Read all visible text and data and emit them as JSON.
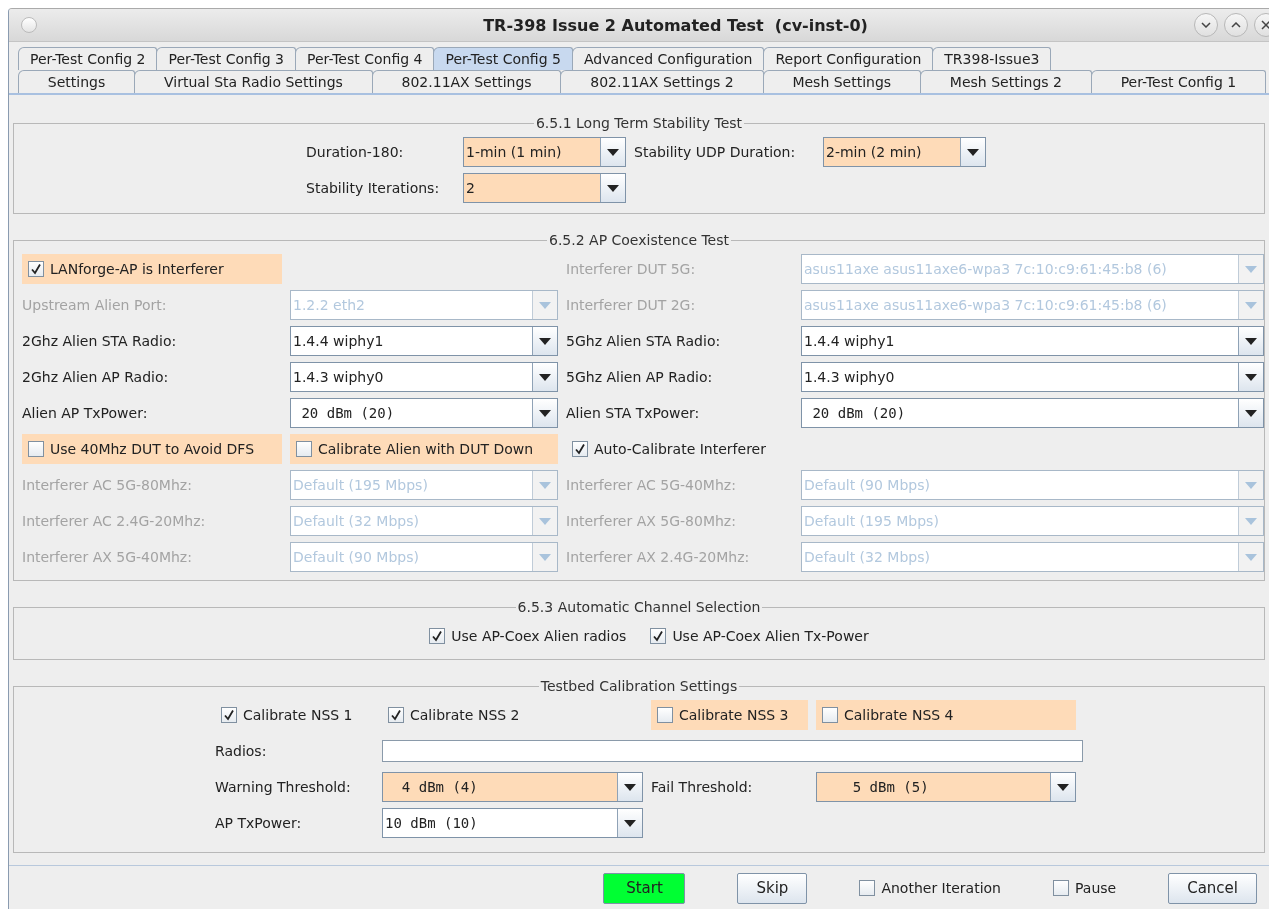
{
  "window": {
    "title": "TR-398 Issue 2 Automated Test  (cv-inst-0)"
  },
  "tab_rows": [
    [
      {
        "label": "Per-Test Config 2",
        "selected": false
      },
      {
        "label": "Per-Test Config 3",
        "selected": false
      },
      {
        "label": "Per-Test Config 4",
        "selected": false
      },
      {
        "label": "Per-Test Config 5",
        "selected": true
      },
      {
        "label": "Advanced Configuration",
        "selected": false
      },
      {
        "label": "Report Configuration",
        "selected": false
      },
      {
        "label": "TR398-Issue3",
        "selected": false
      }
    ],
    [
      {
        "label": "Settings",
        "selected": false
      },
      {
        "label": "Virtual Sta Radio Settings",
        "selected": false
      },
      {
        "label": "802.11AX Settings",
        "selected": false
      },
      {
        "label": "802.11AX Settings 2",
        "selected": false
      },
      {
        "label": "Mesh Settings",
        "selected": false
      },
      {
        "label": "Mesh Settings 2",
        "selected": false
      },
      {
        "label": "Per-Test Config 1",
        "selected": false
      }
    ]
  ],
  "sections": [
    {
      "title": "6.5.1 Long Term Stability Test",
      "rows": [
        [
          {
            "kind": "dropdown",
            "label": "Duration-180:",
            "value": "1-min (1 min)",
            "highlight": true,
            "disabled": false,
            "mono": false
          },
          {
            "kind": "dropdown",
            "label": "Stability UDP Duration:",
            "value": "2-min (2 min)",
            "highlight": true,
            "disabled": false,
            "mono": false
          }
        ],
        [
          {
            "kind": "dropdown",
            "label": "Stability Iterations:",
            "value": "2",
            "highlight": true,
            "disabled": false,
            "mono": false
          }
        ]
      ]
    },
    {
      "title": "6.5.2 AP Coexistence Test",
      "rows": [
        [
          {
            "kind": "checkbox",
            "label": "LANforge-AP is Interferer",
            "checked": true,
            "highlight": true
          },
          {
            "kind": "dropdown",
            "label": "Interferer DUT 5G:",
            "value": "asus11axe asus11axe6-wpa3 7c:10:c9:61:45:b8 (6)",
            "highlight": false,
            "disabled": true,
            "mono": false
          }
        ],
        [
          {
            "kind": "dropdown",
            "label": "Upstream Alien Port:",
            "value": "1.2.2 eth2",
            "highlight": false,
            "disabled": true,
            "mono": false
          },
          {
            "kind": "dropdown",
            "label": "Interferer DUT 2G:",
            "value": "asus11axe asus11axe6-wpa3 7c:10:c9:61:45:b8 (6)",
            "highlight": false,
            "disabled": true,
            "mono": false
          }
        ],
        [
          {
            "kind": "dropdown",
            "label": "2Ghz Alien STA Radio:",
            "value": "1.4.4 wiphy1",
            "highlight": false,
            "disabled": false,
            "mono": false
          },
          {
            "kind": "dropdown",
            "label": "5Ghz Alien STA Radio:",
            "value": "1.4.4 wiphy1",
            "highlight": false,
            "disabled": false,
            "mono": false
          }
        ],
        [
          {
            "kind": "dropdown",
            "label": "2Ghz Alien AP Radio:",
            "value": "1.4.3 wiphy0",
            "highlight": false,
            "disabled": false,
            "mono": false
          },
          {
            "kind": "dropdown",
            "label": "5Ghz Alien AP Radio:",
            "value": "1.4.3 wiphy0",
            "highlight": false,
            "disabled": false,
            "mono": false
          }
        ],
        [
          {
            "kind": "dropdown",
            "label": "Alien AP TxPower:",
            "value": " 20 dBm (20)",
            "highlight": false,
            "disabled": false,
            "mono": true
          },
          {
            "kind": "dropdown",
            "label": "Alien STA TxPower:",
            "value": " 20 dBm (20)",
            "highlight": false,
            "disabled": false,
            "mono": true
          }
        ],
        [
          {
            "kind": "checkbox",
            "label": "Use 40Mhz DUT to Avoid DFS",
            "checked": false,
            "highlight": true
          },
          {
            "kind": "checkbox",
            "label": "Calibrate Alien with DUT Down",
            "checked": false,
            "highlight": true
          },
          {
            "kind": "checkbox",
            "label": "Auto-Calibrate Interferer",
            "checked": true,
            "highlight": false
          }
        ],
        [
          {
            "kind": "dropdown",
            "label": "Interferer AC 5G-80Mhz:",
            "value": "Default (195 Mbps)",
            "highlight": false,
            "disabled": true,
            "mono": false
          },
          {
            "kind": "dropdown",
            "label": "Interferer AC 5G-40Mhz:",
            "value": "Default (90 Mbps)",
            "highlight": false,
            "disabled": true,
            "mono": false
          }
        ],
        [
          {
            "kind": "dropdown",
            "label": "Interferer AC 2.4G-20Mhz:",
            "value": "Default (32 Mbps)",
            "highlight": false,
            "disabled": true,
            "mono": false
          },
          {
            "kind": "dropdown",
            "label": "Interferer AX 5G-80Mhz:",
            "value": "Default (195 Mbps)",
            "highlight": false,
            "disabled": true,
            "mono": false
          }
        ],
        [
          {
            "kind": "dropdown",
            "label": "Interferer AX 5G-40Mhz:",
            "value": "Default (90 Mbps)",
            "highlight": false,
            "disabled": true,
            "mono": false
          },
          {
            "kind": "dropdown",
            "label": "Interferer AX 2.4G-20Mhz:",
            "value": "Default (32 Mbps)",
            "highlight": false,
            "disabled": true,
            "mono": false
          }
        ]
      ]
    },
    {
      "title": "6.5.3 Automatic Channel Selection",
      "rows": [
        [
          {
            "kind": "checkbox",
            "label": "Use AP-Coex Alien radios",
            "checked": true,
            "highlight": false
          },
          {
            "kind": "checkbox",
            "label": "Use AP-Coex Alien Tx-Power",
            "checked": true,
            "highlight": false
          }
        ]
      ]
    },
    {
      "title": "Testbed Calibration Settings",
      "checkboxes": [
        {
          "label": "Calibrate NSS 1",
          "checked": true,
          "highlight": false
        },
        {
          "label": "Calibrate NSS 2",
          "checked": true,
          "highlight": false
        },
        {
          "label": "Calibrate NSS 3",
          "checked": false,
          "highlight": true
        },
        {
          "label": "Calibrate NSS 4",
          "checked": false,
          "highlight": true
        }
      ],
      "rows": [
        [
          {
            "kind": "text",
            "label": "Radios:"
          }
        ],
        [
          {
            "kind": "dropdown",
            "label": "Warning Threshold:",
            "value": "  4 dBm (4)",
            "highlight": true,
            "disabled": false,
            "mono": true
          },
          {
            "kind": "dropdown",
            "label": "Fail Threshold:",
            "value": "    5 dBm (5)",
            "highlight": true,
            "disabled": false,
            "mono": true
          }
        ],
        [
          {
            "kind": "dropdown",
            "label": "AP TxPower:",
            "value": "10 dBm (10)",
            "highlight": false,
            "disabled": false,
            "mono": true
          }
        ]
      ]
    }
  ],
  "buttons": [
    {
      "kind": "button",
      "label": "Start",
      "primary": true
    },
    {
      "kind": "button",
      "label": "Skip",
      "primary": false
    },
    {
      "kind": "checkbox",
      "label": "Another Iteration",
      "checked": false
    },
    {
      "kind": "checkbox",
      "label": "Pause",
      "checked": false
    },
    {
      "kind": "button",
      "label": "Cancel",
      "primary": false
    }
  ]
}
